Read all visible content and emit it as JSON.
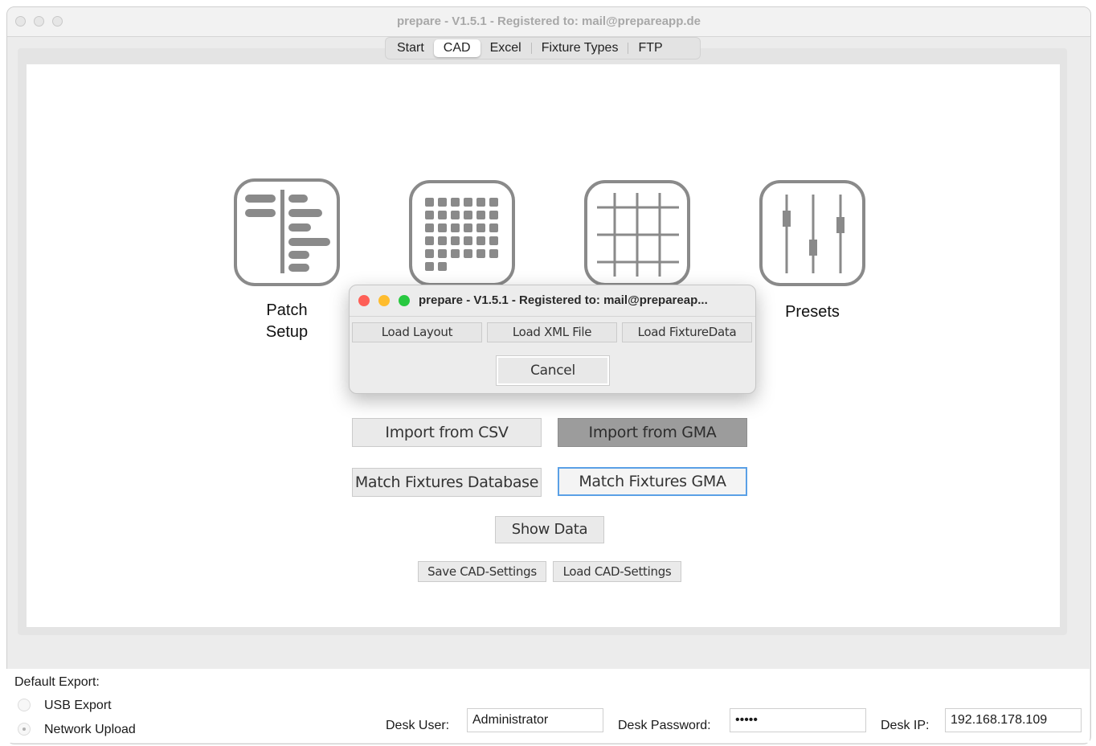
{
  "window": {
    "title": "prepare - V1.5.1 -  Registered to: mail@prepareapp.de"
  },
  "tabs": [
    {
      "label": "Start"
    },
    {
      "label": "CAD",
      "active": true
    },
    {
      "label": "Excel"
    },
    {
      "label": "Fixture Types"
    },
    {
      "label": "FTP"
    }
  ],
  "tiles": {
    "patch_setup": {
      "label_line1": "Patch",
      "label_line2": "Setup",
      "icon": "patch-list-icon"
    },
    "fixtures": {
      "icon": "fixture-grid-icon"
    },
    "layout": {
      "icon": "layout-grid-icon"
    },
    "presets": {
      "label": "Presets",
      "icon": "faders-icon"
    }
  },
  "dialog": {
    "title": "prepare - V1.5.1 -  Registered to: mail@prepareap...",
    "load_layout": "Load Layout",
    "load_xml": "Load XML File",
    "load_fixture_data": "Load FixtureData",
    "cancel": "Cancel"
  },
  "actions": {
    "import_csv": "Import from CSV",
    "import_gma": "Import from GMA",
    "match_database": "Match Fixtures Database",
    "match_gma": "Match Fixtures GMA",
    "show_data": "Show Data",
    "save_settings": "Save CAD-Settings",
    "load_settings": "Load CAD-Settings"
  },
  "export": {
    "heading": "Default Export:",
    "options": [
      {
        "label": "USB Export",
        "selected": false
      },
      {
        "label": "Network Upload",
        "selected": true
      }
    ]
  },
  "desk": {
    "user_label": "Desk User:",
    "user_value": "Administrator",
    "password_label": "Desk Password:",
    "password_value": "•••••",
    "ip_label": "Desk IP:",
    "ip_value": "192.168.178.109"
  },
  "colors": {
    "close": "#fe5f57",
    "minimize": "#febc2e",
    "zoom": "#28c840",
    "focus_ring": "#5aa0e6"
  }
}
